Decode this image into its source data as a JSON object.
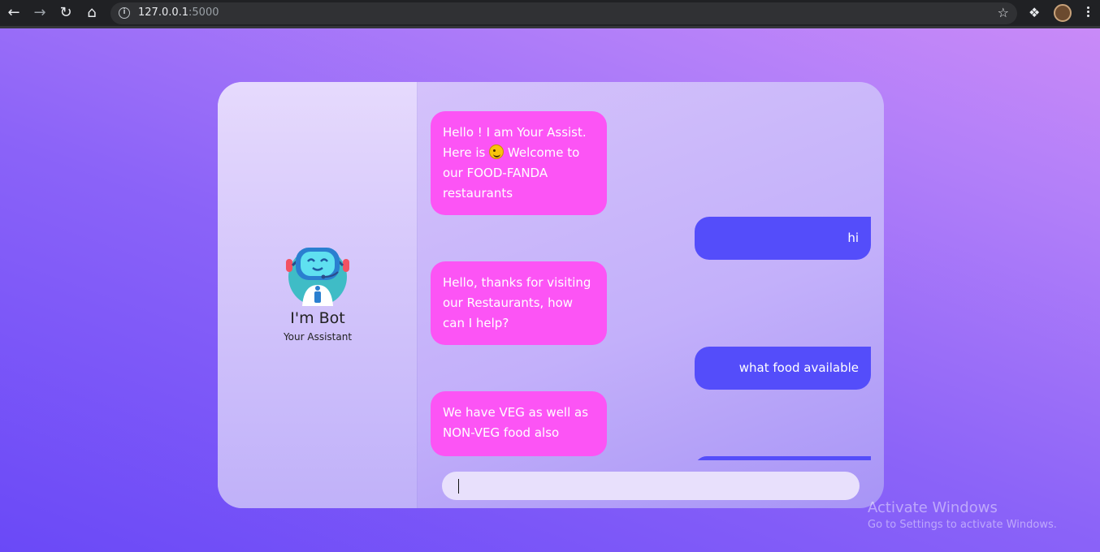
{
  "browser": {
    "url_host": "127.0.0.1",
    "url_port": ":5000"
  },
  "bot": {
    "name": "I'm Bot",
    "subtitle": "Your Assistant"
  },
  "messages": [
    {
      "sender": "bot",
      "text_before_emoji": "Hello ! I am Your Assist. Here is",
      "emoji": "winking-face",
      "text_after_emoji": "Welcome to our FOOD-FANDA restaurants"
    },
    {
      "sender": "user",
      "text": "hi"
    },
    {
      "sender": "bot",
      "text": "Hello, thanks for visiting our Restaurants, how can I help?"
    },
    {
      "sender": "user",
      "text": "what food available"
    },
    {
      "sender": "bot",
      "text": "We have VEG as well as NON-VEG food also"
    }
  ],
  "input": {
    "value": "",
    "placeholder": ""
  },
  "watermark": {
    "title": "Activate Windows",
    "subtitle": "Go to Settings to activate Windows."
  },
  "colors": {
    "bot_bubble": "#fc54f5",
    "user_bubble": "#544dfa",
    "background_start": "#6a49f7",
    "background_end": "#c98af8"
  }
}
